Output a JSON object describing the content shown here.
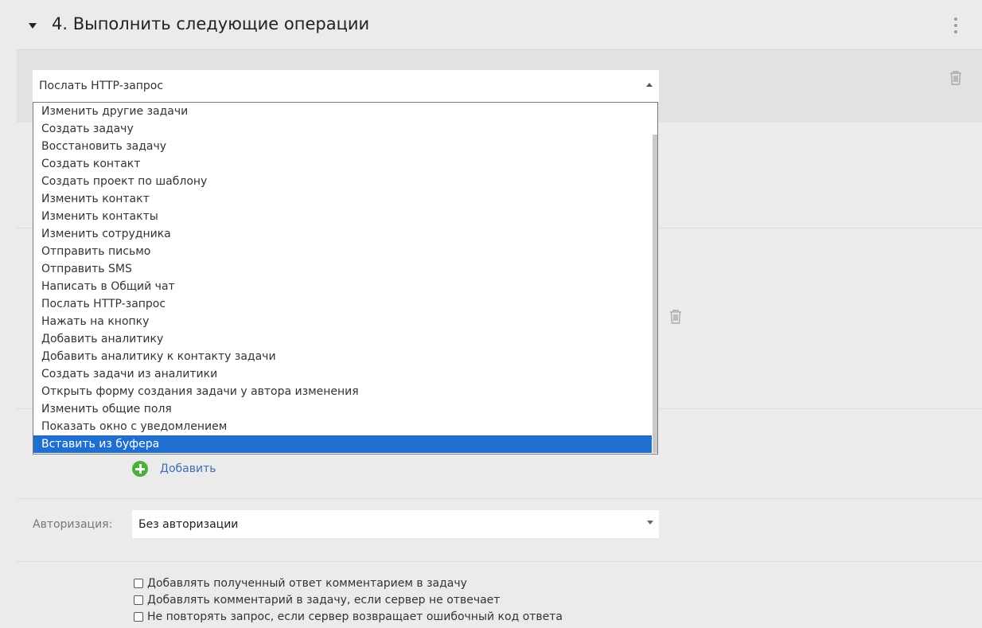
{
  "section": {
    "title": "4. Выполнить следующие операции"
  },
  "operation": {
    "selected": "Послать HTTP-запрос"
  },
  "dropdown": {
    "items": [
      "Изменить другие задачи",
      "Создать задачу",
      "Восстановить задачу",
      "Создать контакт",
      "Создать проект по шаблону",
      "Изменить контакт",
      "Изменить контакты",
      "Изменить сотрудника",
      "Отправить письмо",
      "Отправить SMS",
      "Написать в Общий чат",
      "Послать HTTP-запрос",
      "Нажать на кнопку",
      "Добавить аналитику",
      "Добавить аналитику к контакту задачи",
      "Создать задачи из аналитики",
      "Открыть форму создания задачи у автора изменения",
      "Изменить общие поля",
      "Показать окно с уведомлением",
      "Вставить из буфера"
    ],
    "highlighted": "Вставить из буфера"
  },
  "add": {
    "label": "Добавить"
  },
  "auth": {
    "label": "Авторизация:",
    "value": "Без авторизации"
  },
  "options": [
    {
      "label": "Добавлять полученный ответ комментарием в задачу",
      "checked": false
    },
    {
      "label": "Добавлять комментарий в задачу, если сервер не отвечает",
      "checked": false
    },
    {
      "label": "Не повторять запрос, если сервер возвращает ошибочный код ответа",
      "checked": false
    }
  ],
  "colors": {
    "highlight": "#1f6fd1",
    "link": "#3d6fb5",
    "add": "#4caf3a"
  }
}
